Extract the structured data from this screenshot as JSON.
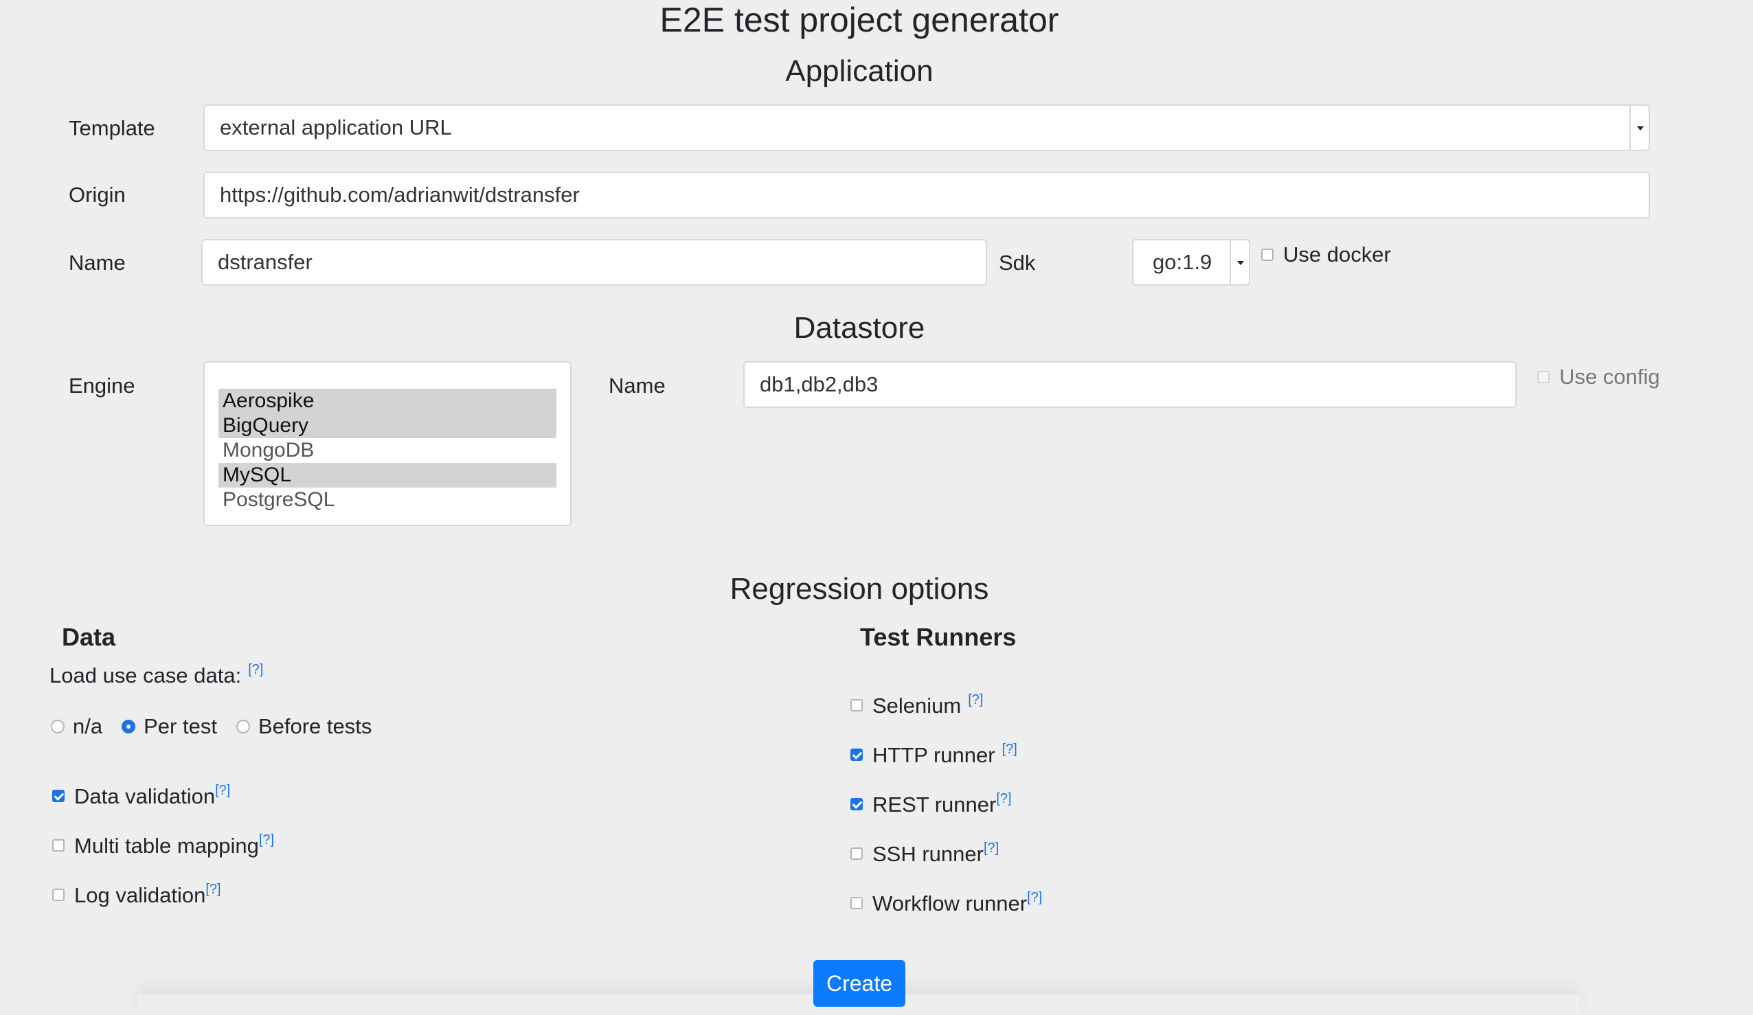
{
  "title": "E2E test project generator",
  "application": {
    "heading": "Application",
    "template_label": "Template",
    "template_value": "external application URL",
    "origin_label": "Origin",
    "origin_value": "https://github.com/adrianwit/dstransfer",
    "name_label": "Name",
    "name_value": "dstransfer",
    "sdk_label": "Sdk",
    "sdk_value": "go:1.9",
    "use_docker_label": "Use docker",
    "use_docker_checked": false
  },
  "datastore": {
    "heading": "Datastore",
    "engine_label": "Engine",
    "engines": [
      {
        "label": "Aerospike",
        "selected": true
      },
      {
        "label": "BigQuery",
        "selected": true
      },
      {
        "label": "MongoDB",
        "selected": false
      },
      {
        "label": "MySQL",
        "selected": true
      },
      {
        "label": "PostgreSQL",
        "selected": false
      }
    ],
    "name_label": "Name",
    "name_value": "db1,db2,db3",
    "use_config_label": "Use config",
    "use_config_checked": false
  },
  "regression": {
    "heading": "Regression options",
    "data": {
      "heading": "Data",
      "load_label": "Load use case data:",
      "help": "[?]",
      "radios": [
        {
          "label": "n/a",
          "checked": false
        },
        {
          "label": "Per test",
          "checked": true
        },
        {
          "label": "Before tests",
          "checked": false
        }
      ],
      "options": [
        {
          "label": "Data validation",
          "checked": true
        },
        {
          "label": "Multi table mapping",
          "checked": false
        },
        {
          "label": "Log validation",
          "checked": false
        }
      ]
    },
    "runners": {
      "heading": "Test Runners",
      "items": [
        {
          "label": "Selenium",
          "checked": false
        },
        {
          "label": "HTTP runner",
          "checked": true
        },
        {
          "label": "REST runner",
          "checked": true
        },
        {
          "label": "SSH runner",
          "checked": false
        },
        {
          "label": "Workflow runner",
          "checked": false
        }
      ]
    }
  },
  "create_label": "Create",
  "colors": {
    "accent": "#0d7bff",
    "background": "#eeeeee"
  }
}
